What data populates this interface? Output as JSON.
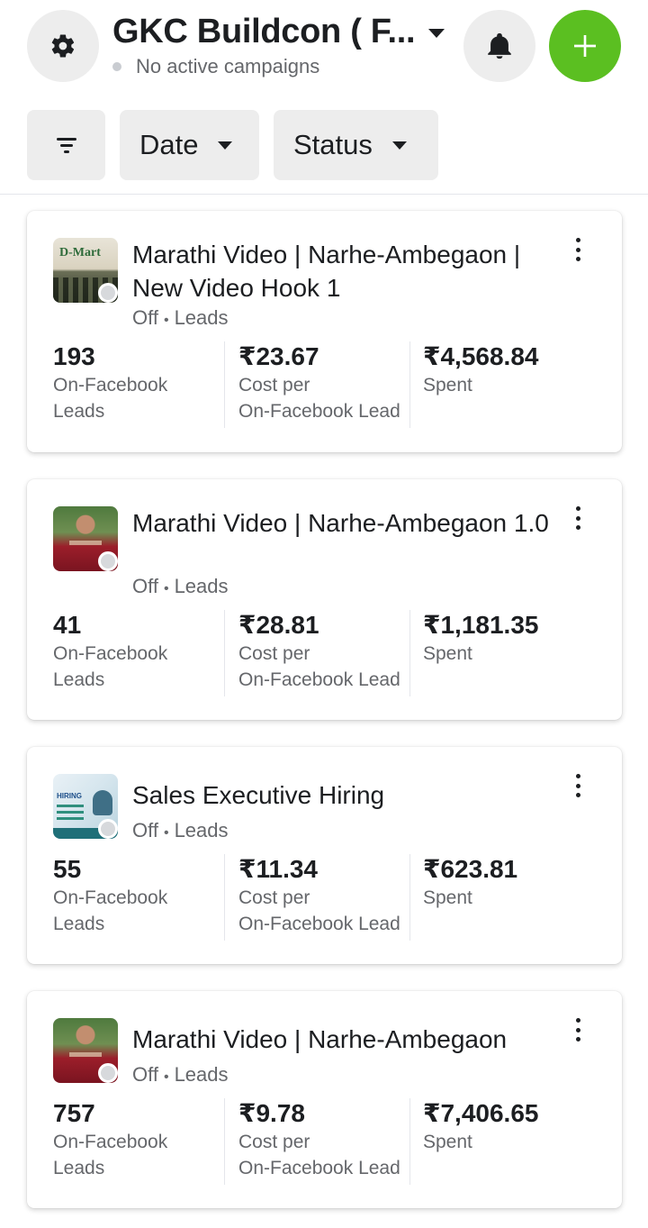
{
  "header": {
    "account_name": "GKC Buildcon ( F...",
    "account_status": "No active campaigns"
  },
  "filters": {
    "date_label": "Date",
    "status_label": "Status"
  },
  "colors": {
    "accent_green": "#5bbf21",
    "chip_bg": "#ededed",
    "secondary_text": "#65676b"
  },
  "campaigns": [
    {
      "title": "Marathi Video | Narhe-Ambegaon | New Video Hook 1",
      "status": "Off",
      "objective": "Leads",
      "thumbnail_text": "D-Mart",
      "metrics": [
        {
          "value": "193",
          "label1": "On-Facebook",
          "label2": "Leads"
        },
        {
          "value": "₹23.67",
          "label1": "Cost per",
          "label2": "On-Facebook Lead"
        },
        {
          "value": "₹4,568.84",
          "label1": "Spent",
          "label2": ""
        }
      ]
    },
    {
      "title": "Marathi Video | Narhe-Ambegaon 1.0",
      "status": "Off",
      "objective": "Leads",
      "thumbnail_text": "",
      "metrics": [
        {
          "value": "41",
          "label1": "On-Facebook",
          "label2": "Leads"
        },
        {
          "value": "₹28.81",
          "label1": "Cost per",
          "label2": "On-Facebook Lead"
        },
        {
          "value": "₹1,181.35",
          "label1": "Spent",
          "label2": ""
        }
      ]
    },
    {
      "title": "Sales Executive Hiring",
      "status": "Off",
      "objective": "Leads",
      "thumbnail_text": "HIRING",
      "metrics": [
        {
          "value": "55",
          "label1": "On-Facebook",
          "label2": "Leads"
        },
        {
          "value": "₹11.34",
          "label1": "Cost per",
          "label2": "On-Facebook Lead"
        },
        {
          "value": "₹623.81",
          "label1": "Spent",
          "label2": ""
        }
      ]
    },
    {
      "title": "Marathi Video | Narhe-Ambegaon",
      "status": "Off",
      "objective": "Leads",
      "thumbnail_text": "",
      "metrics": [
        {
          "value": "757",
          "label1": "On-Facebook",
          "label2": "Leads"
        },
        {
          "value": "₹9.78",
          "label1": "Cost per",
          "label2": "On-Facebook Lead"
        },
        {
          "value": "₹7,406.65",
          "label1": "Spent",
          "label2": ""
        }
      ]
    }
  ]
}
